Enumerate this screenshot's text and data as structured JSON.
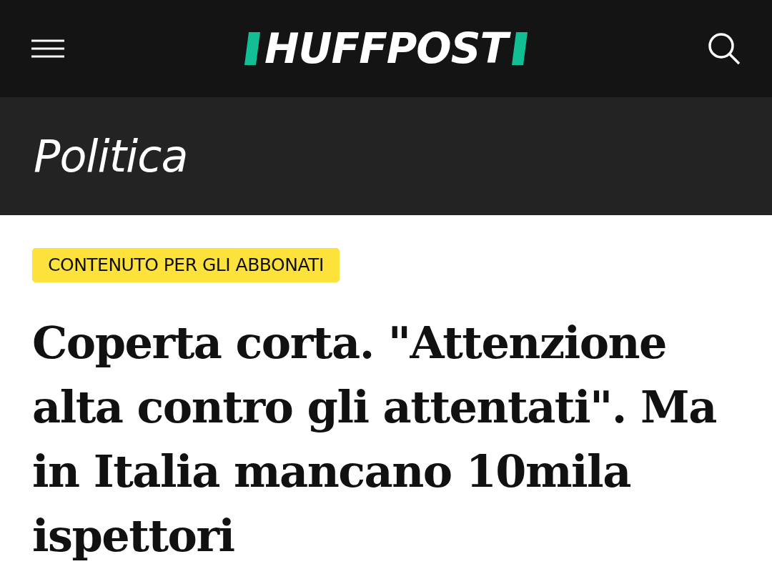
{
  "header": {
    "logo": "HUFFPOST"
  },
  "section": {
    "title": "Politica"
  },
  "article": {
    "badge": "CONTENUTO PER GLI ABBONATI",
    "headline": "Coperta corta. \"Attenzione alta contro gli attentati\". Ma in Italia mancano 10mila ispettori"
  }
}
